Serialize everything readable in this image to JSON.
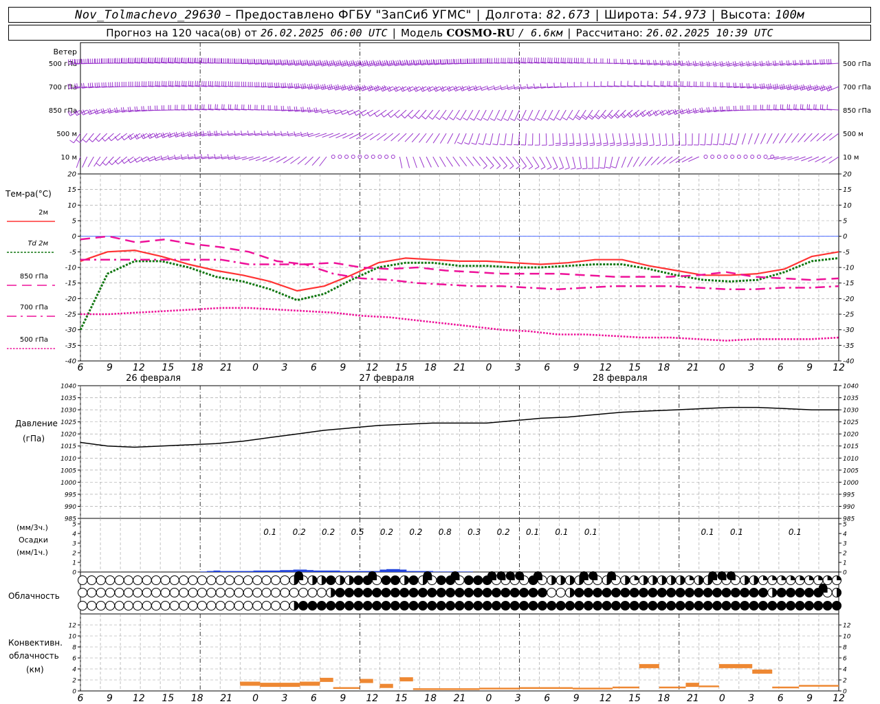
{
  "header": {
    "station": "Nov_Tolmachevo_29630",
    "provider": "– Предоставлено ФГБУ \"ЗапСиб УГМС\"",
    "lon_label": "Долгота:",
    "lon_value": "82.673",
    "lat_label": "Широта:",
    "lat_value": "54.973",
    "alt_label": "Высота:",
    "alt_value": "100м",
    "forecast_label": "Прогноз на 120 часа(ов) от",
    "forecast_start": "26.02.2025 06:00 UTC",
    "model_label": "Модель",
    "model_name": "COSMO-RU",
    "model_res": "/ 6.6км",
    "calc_label": "Рассчитано:",
    "calc_time": "26.02.2025 10:39 UTC"
  },
  "x_axis": {
    "hour_labels": [
      "6",
      "9",
      "12",
      "15",
      "18",
      "21",
      "0",
      "3",
      "6",
      "9",
      "12",
      "15",
      "18",
      "21",
      "0",
      "3",
      "6",
      "9",
      "12",
      "15",
      "18",
      "21",
      "0",
      "3",
      "6",
      "9",
      "12"
    ],
    "day_labels": [
      {
        "text": "26 февраля",
        "slot": 3
      },
      {
        "text": "27 февраля",
        "slot": 11
      },
      {
        "text": "28 февраля",
        "slot": 19
      }
    ]
  },
  "wind": {
    "title": "Ветер",
    "levels": [
      "500 гПа",
      "700 гПа",
      "850 гПа",
      "500 м",
      "10  м"
    ],
    "color": "#9933cc"
  },
  "colors": {
    "t2m": "#ff3333",
    "td2m": "#117711",
    "t850": "#ee1199",
    "t700": "#ee1199",
    "t500": "#ee1199",
    "zero_line": "#3355ff",
    "pressure": "#000000",
    "precip": "#2244dd",
    "convective": "#ee8833",
    "grid": "#999999"
  },
  "chart_data": [
    {
      "type": "line",
      "title": "",
      "ylabel": "Тем-ра(°C)",
      "ylim": [
        -40,
        20
      ],
      "yticks": [
        20,
        15,
        10,
        5,
        0,
        -5,
        -10,
        -15,
        -20,
        -25,
        -30,
        -35,
        -40
      ],
      "x_unit": "hours since 26.02.2025 06:00 UTC",
      "x": [
        0,
        3,
        6,
        9,
        12,
        15,
        18,
        21,
        24,
        27,
        30,
        33,
        36,
        39,
        42,
        45,
        48,
        51,
        54,
        57,
        60,
        63,
        66,
        69,
        72,
        75,
        78
      ],
      "series": [
        {
          "name": "2м",
          "style": "solid",
          "values": [
            -8,
            -5,
            -4.5,
            -6.5,
            -9,
            -11,
            -12.5,
            -14.5,
            -17.5,
            -16,
            -12.5,
            -8.5,
            -7,
            -7.5,
            -8,
            -8,
            -8.5,
            -9,
            -8.5,
            -7.5,
            -7.5,
            -9.5,
            -11,
            -12.5,
            -12.5,
            -12,
            -10.5,
            -6.5,
            -5
          ]
        },
        {
          "name": "Td 2м",
          "style": "dotted",
          "values": [
            -30,
            -12,
            -8,
            -8,
            -10,
            -13,
            -14.5,
            -17,
            -20.5,
            -18.5,
            -14,
            -10,
            -8.5,
            -8.5,
            -9.5,
            -9.5,
            -10,
            -10,
            -9.5,
            -9,
            -9,
            -10.5,
            -12.5,
            -14,
            -14.5,
            -14,
            -11.5,
            -8,
            -7
          ]
        },
        {
          "name": "850 гПа",
          "style": "dash",
          "values": [
            -1,
            0,
            -2,
            -1,
            -2.5,
            -3.5,
            -5,
            -8,
            -9,
            -8.5,
            -10,
            -10.5,
            -10,
            -11,
            -11.5,
            -12,
            -12,
            -12,
            -12.5,
            -13,
            -13,
            -13,
            -12.5,
            -11.5,
            -13,
            -13.5,
            -14,
            -13.5
          ]
        },
        {
          "name": "700 гПа",
          "style": "dashdot",
          "values": [
            -7.5,
            -7.5,
            -7.5,
            -7.5,
            -7.5,
            -7.5,
            -9,
            -9,
            -9,
            -12,
            -13.5,
            -14,
            -15,
            -15.5,
            -16,
            -16,
            -16.5,
            -17,
            -16.5,
            -16,
            -16,
            -16,
            -16.5,
            -17,
            -17,
            -16.5,
            -16.5,
            -16
          ]
        },
        {
          "name": "500 гПа",
          "style": "fineDot",
          "values": [
            -25,
            -25,
            -24.5,
            -24,
            -23.5,
            -23,
            -23,
            -23.5,
            -24,
            -24.5,
            -25.5,
            -26,
            -27,
            -28,
            -29,
            -30,
            -30.5,
            -31.5,
            -31.5,
            -32,
            -32.5,
            -32.5,
            -33,
            -33.5,
            -33,
            -33,
            -33,
            -32.5
          ]
        }
      ]
    },
    {
      "type": "line",
      "title": "",
      "ylabel": "Давление",
      "yunit": "(гПа)",
      "ylim": [
        985,
        1040
      ],
      "yticks": [
        1040,
        1035,
        1030,
        1025,
        1020,
        1015,
        1010,
        1005,
        1000,
        995,
        990,
        985
      ],
      "x": [
        0,
        3,
        6,
        9,
        12,
        15,
        18,
        21,
        24,
        27,
        30,
        33,
        36,
        39,
        42,
        45,
        48,
        51,
        54,
        57,
        60,
        63,
        66,
        69,
        72,
        75,
        78,
        81,
        84
      ],
      "series": [
        {
          "name": "",
          "values": [
            1016.5,
            1015,
            1014.5,
            1015,
            1015.5,
            1016,
            1017,
            1018.5,
            1020,
            1021.5,
            1022.5,
            1023.5,
            1024,
            1024.5,
            1024.5,
            1024.5,
            1025.5,
            1026.5,
            1027,
            1028,
            1029,
            1029.5,
            1030,
            1030.5,
            1031,
            1031,
            1030.5,
            1030,
            1030
          ]
        }
      ]
    },
    {
      "type": "bar",
      "title": "",
      "ylabel": "(мм/3ч.)",
      "ylabel2": "Осадки",
      "ylabel3": "(мм/1ч.)",
      "ylim": [
        0,
        5
      ],
      "yticks": [
        5,
        4,
        3,
        2,
        1,
        0
      ],
      "labels": [
        {
          "slot": 7,
          "text": "0.1"
        },
        {
          "slot": 8,
          "text": "0.2"
        },
        {
          "slot": 9,
          "text": "0.2"
        },
        {
          "slot": 10,
          "text": "0.5"
        },
        {
          "slot": 11,
          "text": "0.2"
        },
        {
          "slot": 12,
          "text": "0.2"
        },
        {
          "slot": 13,
          "text": "0.8"
        },
        {
          "slot": 14,
          "text": "0.3"
        },
        {
          "slot": 15,
          "text": "0.2"
        },
        {
          "slot": 16,
          "text": "0.1"
        },
        {
          "slot": 17,
          "text": "0.1"
        },
        {
          "slot": 18,
          "text": "0.1"
        },
        {
          "slot": 22,
          "text": "0.1"
        },
        {
          "slot": 23,
          "text": "0.1"
        },
        {
          "slot": 25,
          "text": "0.1"
        }
      ],
      "hourly_x": [
        18,
        19,
        20,
        21,
        22,
        23,
        24,
        25,
        26,
        27,
        28,
        29,
        30,
        31,
        32,
        33,
        34,
        35,
        36,
        37,
        38,
        39,
        40,
        41,
        42,
        43,
        44,
        45,
        46,
        47,
        48,
        49,
        50,
        51,
        52,
        53,
        54,
        55,
        56,
        57,
        58
      ],
      "hourly_values": [
        0.05,
        0.1,
        0.15,
        0.1,
        0.1,
        0.1,
        0.1,
        0.1,
        0.15,
        0.15,
        0.15,
        0.15,
        0.2,
        0.2,
        0.25,
        0.25,
        0.2,
        0.15,
        0.15,
        0.15,
        0.15,
        0.1,
        0.1,
        0.1,
        0.1,
        0.1,
        0.1,
        0.25,
        0.3,
        0.3,
        0.25,
        0.1,
        0.1,
        0.1,
        0.1,
        0.05,
        0.05,
        0.05,
        0.05,
        0.05,
        0.05
      ]
    },
    {
      "type": "table",
      "title": "",
      "ylabel": "Облачность",
      "rows_description": "cloud cover symbols per hour (fraction 0–1), three rows",
      "rows": [
        [
          0,
          0,
          0,
          0,
          0,
          0,
          0,
          0,
          0,
          0,
          0,
          0,
          0,
          0,
          0,
          0,
          0,
          0,
          0,
          0,
          0,
          0,
          0,
          0.5,
          0.75,
          0.5,
          0.5,
          1,
          0.5,
          0.5,
          1,
          1,
          0.75,
          1,
          1,
          0.5,
          1,
          0.5,
          0.75,
          1,
          1,
          0.75,
          1,
          1,
          1,
          0.75,
          0.75,
          0.75,
          0.75,
          1,
          0.75,
          0.5,
          0.5,
          0.5,
          0.5,
          0.75,
          0.75,
          0.5,
          0.75,
          0.5,
          0.25,
          0.5,
          0.5,
          0.5,
          0.5,
          0.5,
          0.25,
          0.5,
          0.5,
          0.75,
          0.75,
          0.75,
          0.5,
          0.5,
          0.25,
          0.25,
          0.25,
          0.25,
          0.25,
          0.25,
          0.25,
          0.25,
          0.25
        ],
        [
          0,
          0,
          0,
          0,
          0,
          0,
          0,
          0,
          0,
          0,
          0,
          0,
          0,
          0,
          0,
          0,
          0,
          0,
          0,
          0,
          0,
          0,
          0,
          0,
          0,
          0,
          0,
          0.5,
          1,
          1,
          1,
          1,
          1,
          1,
          1,
          1,
          1,
          1,
          1,
          1,
          1,
          1,
          1,
          1,
          1,
          1,
          1,
          1,
          1,
          1,
          1,
          0,
          0,
          0.5,
          1,
          1,
          1,
          1,
          1,
          1,
          1,
          1,
          1,
          1,
          1,
          1,
          1,
          1,
          1,
          1,
          1,
          1,
          1,
          1,
          1,
          0.5,
          1,
          1,
          1,
          1,
          1,
          0.75,
          0.5
        ],
        [
          0,
          0,
          0,
          0,
          0,
          0,
          0,
          0,
          0,
          0,
          0,
          0,
          0,
          0,
          0,
          0,
          0,
          0,
          0,
          0,
          0,
          0,
          0,
          0.5,
          1,
          1,
          1,
          1,
          1,
          1,
          1,
          1,
          1,
          1,
          1,
          1,
          1,
          1,
          1,
          1,
          1,
          1,
          1,
          1,
          1,
          1,
          1,
          1,
          1,
          1,
          1,
          1,
          1,
          1,
          1,
          1,
          1,
          1,
          1,
          1,
          1,
          1,
          1,
          1,
          1,
          1,
          1,
          1,
          1,
          1,
          1,
          1,
          1,
          1,
          1,
          1,
          1,
          1,
          1,
          1,
          1,
          1,
          1
        ]
      ]
    },
    {
      "type": "bar",
      "title": "",
      "ylabel": "Конвективн.",
      "ylabel2": "облачность",
      "ylabel3": "(км)",
      "ylim": [
        0,
        14
      ],
      "yticks": [
        12,
        10,
        8,
        6,
        4,
        2,
        0
      ],
      "segments": [
        {
          "x0": 24,
          "x1": 27,
          "h": 1.5
        },
        {
          "x0": 27,
          "x1": 33,
          "h": 1.3
        },
        {
          "x0": 33,
          "x1": 36,
          "h": 1.5
        },
        {
          "x0": 36,
          "x1": 38,
          "h": 2.2
        },
        {
          "x0": 38,
          "x1": 42,
          "h": 0.5
        },
        {
          "x0": 42,
          "x1": 44,
          "h": 2.0
        },
        {
          "x0": 45,
          "x1": 47,
          "h": 1.1
        },
        {
          "x0": 48,
          "x1": 50,
          "h": 2.3
        },
        {
          "x0": 50,
          "x1": 60,
          "h": 0.3
        },
        {
          "x0": 60,
          "x1": 66,
          "h": 0.4
        },
        {
          "x0": 66,
          "x1": 74,
          "h": 0.5
        },
        {
          "x0": 74,
          "x1": 80,
          "h": 0.4
        },
        {
          "x0": 80,
          "x1": 84,
          "h": 0.6
        },
        {
          "x0": 84,
          "x1": 87,
          "h": 4.7
        },
        {
          "x0": 87,
          "x1": 91,
          "h": 0.6
        },
        {
          "x0": 91,
          "x1": 93,
          "h": 1.3
        },
        {
          "x0": 93,
          "x1": 96,
          "h": 0.8
        },
        {
          "x0": 96,
          "x1": 101,
          "h": 4.7
        },
        {
          "x0": 101,
          "x1": 104,
          "h": 3.7
        },
        {
          "x0": 104,
          "x1": 108,
          "h": 0.6
        },
        {
          "x0": 108,
          "x1": 114,
          "h": 0.9
        }
      ]
    }
  ]
}
